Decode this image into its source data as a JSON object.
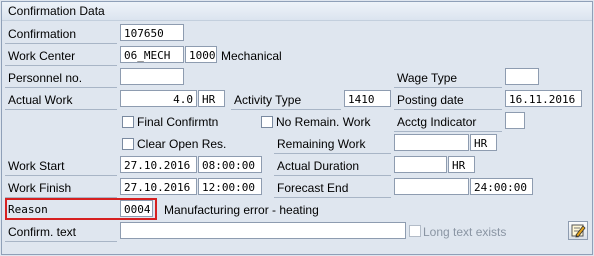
{
  "title": "Confirmation Data",
  "labels": {
    "confirmation": "Confirmation",
    "work_center": "Work Center",
    "personnel_no": "Personnel no.",
    "wage_type": "Wage Type",
    "actual_work": "Actual Work",
    "activity_type": "Activity Type",
    "posting_date": "Posting date",
    "final_confirmation": "Final Confirmtn",
    "no_remain_work": "No Remain. Work",
    "acctg_indicator": "Acctg Indicator",
    "clear_open_res": "Clear Open Res.",
    "remaining_work": "Remaining Work",
    "work_start": "Work Start",
    "actual_duration": "Actual Duration",
    "work_finish": "Work Finish",
    "forecast_end": "Forecast End",
    "reason": "Reason",
    "confirm_text": "Confirm. text",
    "long_text_exists": "Long text exists"
  },
  "values": {
    "confirmation": "107650",
    "work_center": "06_MECH",
    "plant": "1000",
    "work_center_desc": "Mechanical",
    "personnel_no": "",
    "wage_type": "",
    "actual_work": "4.0",
    "actual_work_unit": "HR",
    "activity_type": "1410",
    "posting_date": "16.11.2016",
    "acctg_indicator": "",
    "remaining_work": "",
    "remaining_work_unit": "HR",
    "work_start_date": "27.10.2016",
    "work_start_time": "08:00:00",
    "actual_duration": "",
    "actual_duration_unit": "HR",
    "work_finish_date": "27.10.2016",
    "work_finish_time": "12:00:00",
    "forecast_end_date": "",
    "forecast_end_time": "24:00:00",
    "reason_code": "0004",
    "reason_desc": "Manufacturing error - heating",
    "confirm_text": ""
  },
  "checkboxes": {
    "final_confirmation": false,
    "no_remain_work": false,
    "clear_open_res": false,
    "long_text_exists": false
  },
  "icons": {
    "edit_long_text": "pencil-edit-icon"
  },
  "colors": {
    "highlight": "#d62020",
    "background": "#dfe6ef"
  }
}
